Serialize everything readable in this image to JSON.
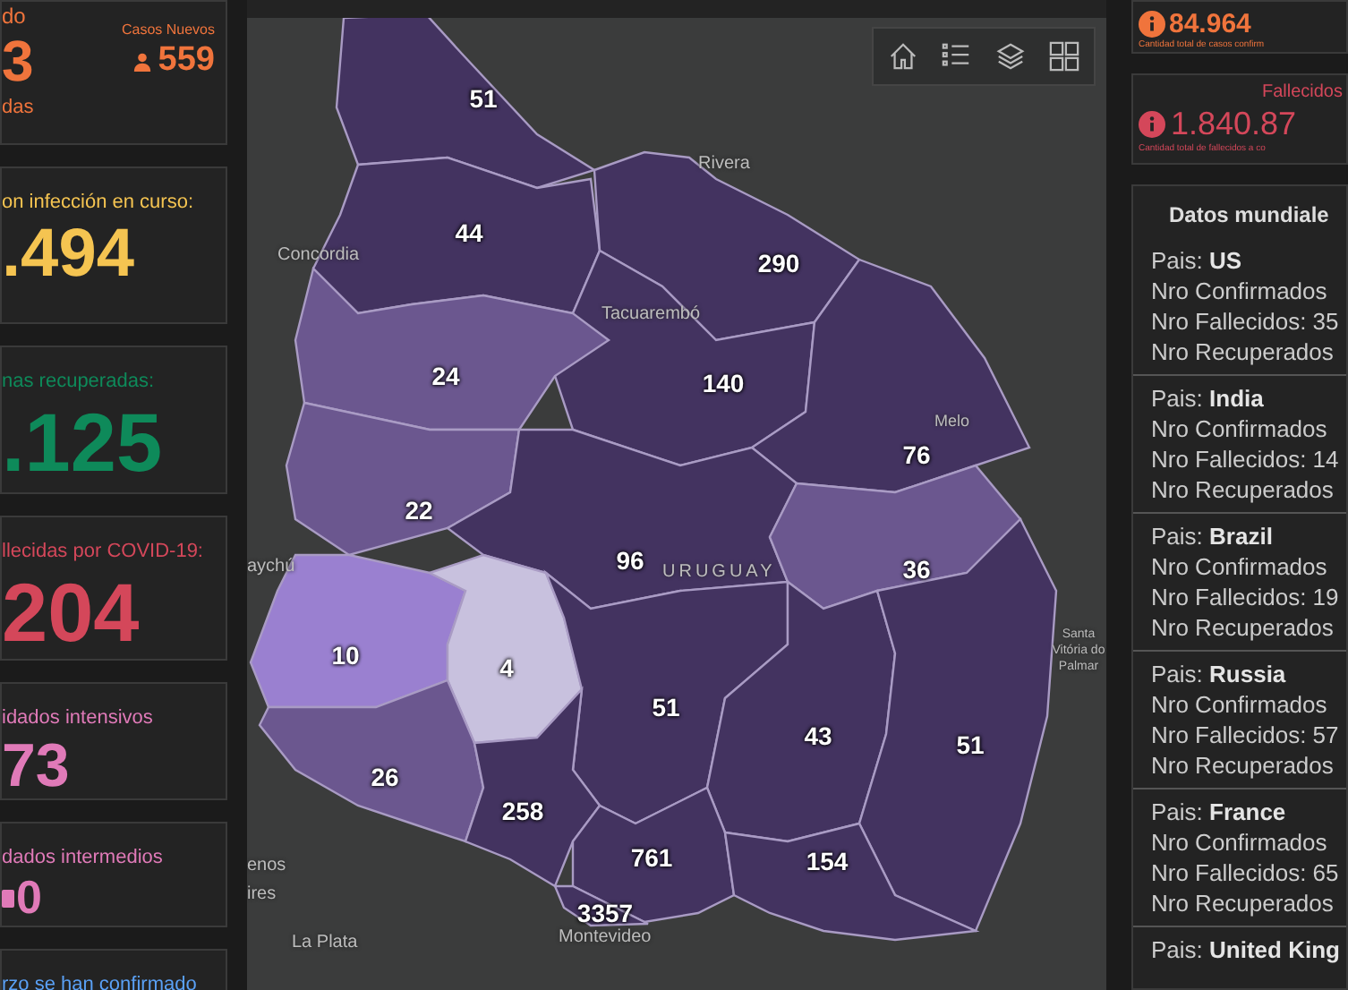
{
  "left_cards": [
    {
      "kind": "new_cases",
      "label": "do",
      "value": "3",
      "sub": "das",
      "side_label": "Casos Nuevos",
      "side_value": "559",
      "color": "#f0743c"
    },
    {
      "kind": "stat",
      "label": "on infección en curso:",
      "value": ".494",
      "color": "#f5c451"
    },
    {
      "kind": "stat",
      "label": "nas recuperadas:",
      "value": ".125",
      "color": "#0e8a5a"
    },
    {
      "kind": "stat",
      "label": "llecidas por COVID-19:",
      "value": "204",
      "color": "#d4475a"
    },
    {
      "kind": "stat",
      "label": "idados intensivos",
      "value": "73",
      "color": "#e07ab8"
    },
    {
      "kind": "icon_stat",
      "label": "dados intermedios",
      "value": "0",
      "color": "#e07ab8"
    },
    {
      "kind": "stat",
      "label": "rzo se han confirmado",
      "color": "#5aa0f5"
    }
  ],
  "map": {
    "departments": [
      {
        "value": "51",
        "color": "#433360"
      },
      {
        "value": "44",
        "color": "#433360"
      },
      {
        "value": "290",
        "color": "#433360"
      },
      {
        "value": "140",
        "color": "#433360"
      },
      {
        "value": "24",
        "color": "#6b578f"
      },
      {
        "value": "76",
        "color": "#433360"
      },
      {
        "value": "22",
        "color": "#6b578f"
      },
      {
        "value": "96",
        "color": "#433360"
      },
      {
        "value": "36",
        "color": "#6b578f"
      },
      {
        "value": "10",
        "color": "#9a80d0"
      },
      {
        "value": "4",
        "color": "#c8c1de"
      },
      {
        "value": "51",
        "color": "#433360"
      },
      {
        "value": "43",
        "color": "#433360"
      },
      {
        "value": "51",
        "color": "#433360"
      },
      {
        "value": "26",
        "color": "#6b578f"
      },
      {
        "value": "258",
        "color": "#433360"
      },
      {
        "value": "761",
        "color": "#433360"
      },
      {
        "value": "154",
        "color": "#433360"
      },
      {
        "value": "3357",
        "color": "#433360"
      }
    ],
    "place_labels": [
      "Rivera",
      "Concordia",
      "Tacuarembó",
      "Melo",
      "URUGUAY",
      "aychú",
      "Santa Vitória do Palmar",
      "enos",
      "ires",
      "La Plata",
      "Montevideo"
    ]
  },
  "right_cards": [
    {
      "kind": "confirmed",
      "value": "84.964",
      "caption": "Cantidad total de casos confirm",
      "color": "#f0743c"
    },
    {
      "kind": "deaths",
      "title": "Fallecidos",
      "value": "1.840.87",
      "caption": "Cantidad total de fallecidos a co",
      "color": "#d4475a"
    }
  ],
  "world": {
    "title": "Datos mundiale",
    "countries": [
      {
        "prefix": "Pais:",
        "name": "US",
        "confirmed": "Nro Confirmados",
        "deaths": "Nro Fallecidos: 35",
        "recovered": "Nro Recuperados"
      },
      {
        "prefix": "Pais:",
        "name": "India",
        "confirmed": "Nro Confirmados",
        "deaths": "Nro Fallecidos: 14",
        "recovered": "Nro Recuperados"
      },
      {
        "prefix": "Pais:",
        "name": "Brazil",
        "confirmed": "Nro Confirmados",
        "deaths": "Nro Fallecidos: 19",
        "recovered": "Nro Recuperados"
      },
      {
        "prefix": "Pais:",
        "name": "Russia",
        "confirmed": "Nro Confirmados",
        "deaths": "Nro Fallecidos: 57",
        "recovered": "Nro Recuperados"
      },
      {
        "prefix": "Pais:",
        "name": "France",
        "confirmed": "Nro Confirmados",
        "deaths": "Nro Fallecidos: 65",
        "recovered": "Nro Recuperados"
      },
      {
        "prefix": "Pais:",
        "name": "United King"
      }
    ]
  }
}
